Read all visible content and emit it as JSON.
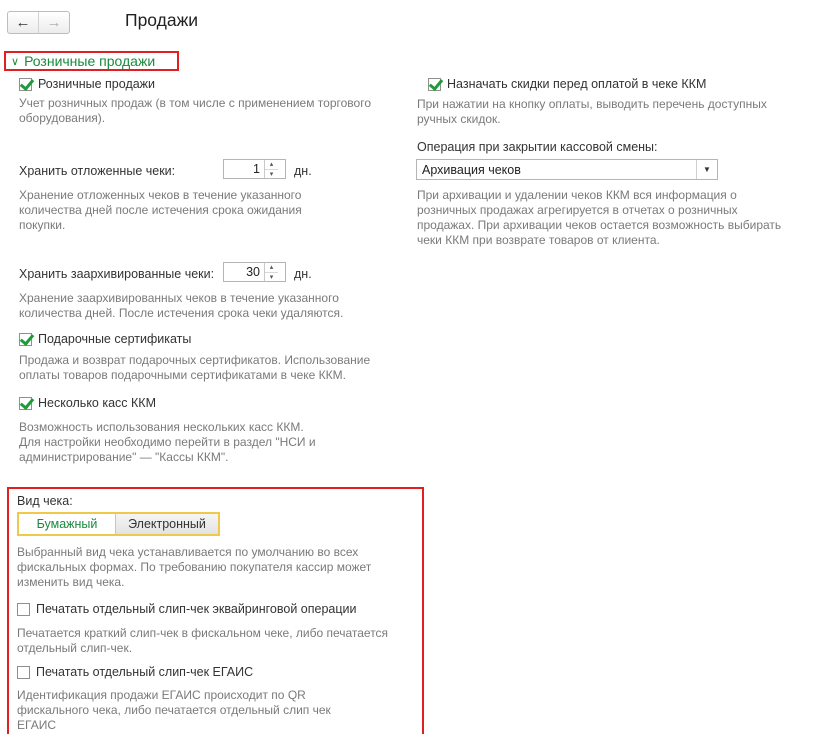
{
  "nav": {
    "back_icon": "←",
    "forward_icon": "→"
  },
  "page_title": "Продажи",
  "group": {
    "chevron": "∨",
    "title": "Розничные продажи"
  },
  "left": {
    "retail_checkbox": {
      "label": "Розничные продажи",
      "checked": true
    },
    "retail_hint": [
      "Учет розничных продаж (в том числе с применением торгового",
      "оборудования)."
    ],
    "deferred": {
      "label": "Хранить отложенные чеки:",
      "value": "1",
      "unit": "дн.",
      "hint": [
        "Хранение отложенных чеков в течение указанного",
        "количества дней после истечения срока ожидания",
        "покупки."
      ]
    },
    "archived": {
      "label": "Хранить заархивированные чеки:",
      "value": "30",
      "unit": "дн.",
      "hint": [
        "Хранение заархивированных чеков в течение указанного",
        "количества дней. После истечения срока чеки удаляются."
      ]
    },
    "gift_checkbox": {
      "label": "Подарочные сертификаты",
      "checked": true
    },
    "gift_hint": [
      "Продажа и возврат подарочных сертификатов. Использование",
      "оплаты товаров подарочными сертификатами в чеке ККМ."
    ],
    "multi_checkbox": {
      "label": "Несколько касс ККМ",
      "checked": true
    },
    "multi_hint": [
      "Возможность использования нескольких касс ККМ.",
      "Для настройки необходимо перейти в раздел \"НСИ и",
      "администрирование\" — \"Кассы ККМ\"."
    ]
  },
  "receipt": {
    "label": "Вид чека:",
    "options": [
      "Бумажный",
      "Электронный"
    ],
    "selected": "Бумажный",
    "hint": [
      "Выбранный вид чека устанавливается по умолчанию во всех",
      "фискальных формах. По требованию покупателя кассир может",
      "изменить вид чека."
    ],
    "slip_checkbox": {
      "label": "Печатать отдельный слип-чек эквайринговой операции",
      "checked": false
    },
    "slip_hint": [
      "Печатается краткий слип-чек в фискальном чеке, либо печатается",
      "отдельный слип-чек."
    ],
    "egais_checkbox": {
      "label": "Печатать отдельный слип-чек ЕГАИС",
      "checked": false
    },
    "egais_hint": [
      "Идентификация продажи ЕГАИС происходит по QR",
      "фискального чека, либо печатается отдельный слип чек",
      "ЕГАИС"
    ]
  },
  "right": {
    "discount_checkbox": {
      "label": "Назначать скидки перед оплатой в чеке ККМ",
      "checked": true
    },
    "discount_hint": [
      "При нажатии на кнопку оплаты, выводить перечень доступных",
      "ручных скидок."
    ],
    "operation_label": "Операция при закрытии кассовой смены:",
    "operation_value": "Архивация чеков",
    "operation_hint": [
      "При архивации и удалении чеков ККМ вся информация о",
      "розничных продажах агрегируется в отчетах о розничных",
      "продажах. При архивации чеков остается возможность выбирать",
      "чеки ККМ при возврате товаров от клиента."
    ]
  },
  "colors": {
    "accent_green": "#1a8a3c",
    "highlight_red": "#e02020",
    "toggle_border": "#f0c94a",
    "hint_gray": "#7a7a7a"
  }
}
